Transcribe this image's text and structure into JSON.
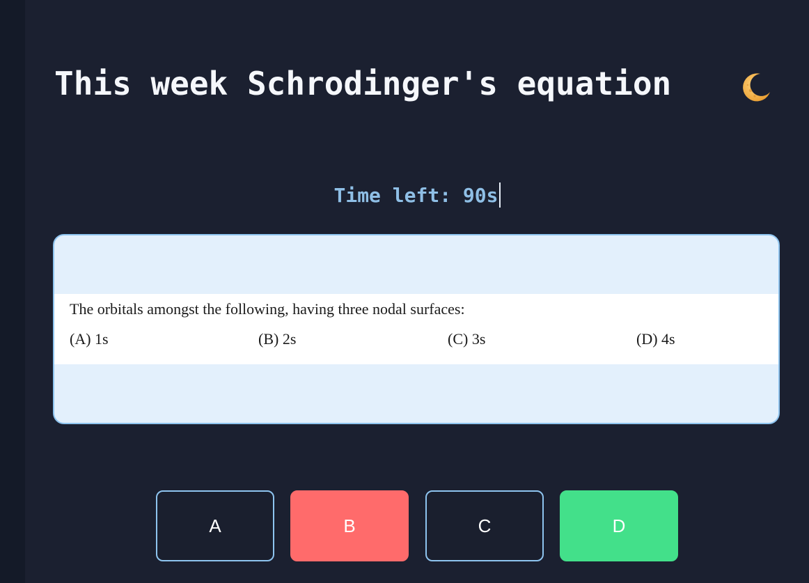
{
  "header": {
    "title": "This week Schrodinger's equation",
    "icon": "crescent-moon-icon"
  },
  "timer": {
    "text": "Time left: 90s"
  },
  "question": {
    "text": "The orbitals amongst the following, having three nodal surfaces:",
    "options": [
      {
        "label": "(A) 1s"
      },
      {
        "label": "(B) 2s"
      },
      {
        "label": "(C) 3s"
      },
      {
        "label": "(D) 4s"
      }
    ]
  },
  "answers": [
    {
      "label": "A",
      "state": "default"
    },
    {
      "label": "B",
      "state": "incorrect"
    },
    {
      "label": "C",
      "state": "default"
    },
    {
      "label": "D",
      "state": "correct"
    }
  ],
  "colors": {
    "background": "#1b2030",
    "title": "#f5f7fb",
    "timer": "#8fbfe6",
    "card_background": "#e3f0fc",
    "card_border": "#8ec4ef",
    "incorrect": "#ff6b6b",
    "correct": "#43e08a"
  }
}
